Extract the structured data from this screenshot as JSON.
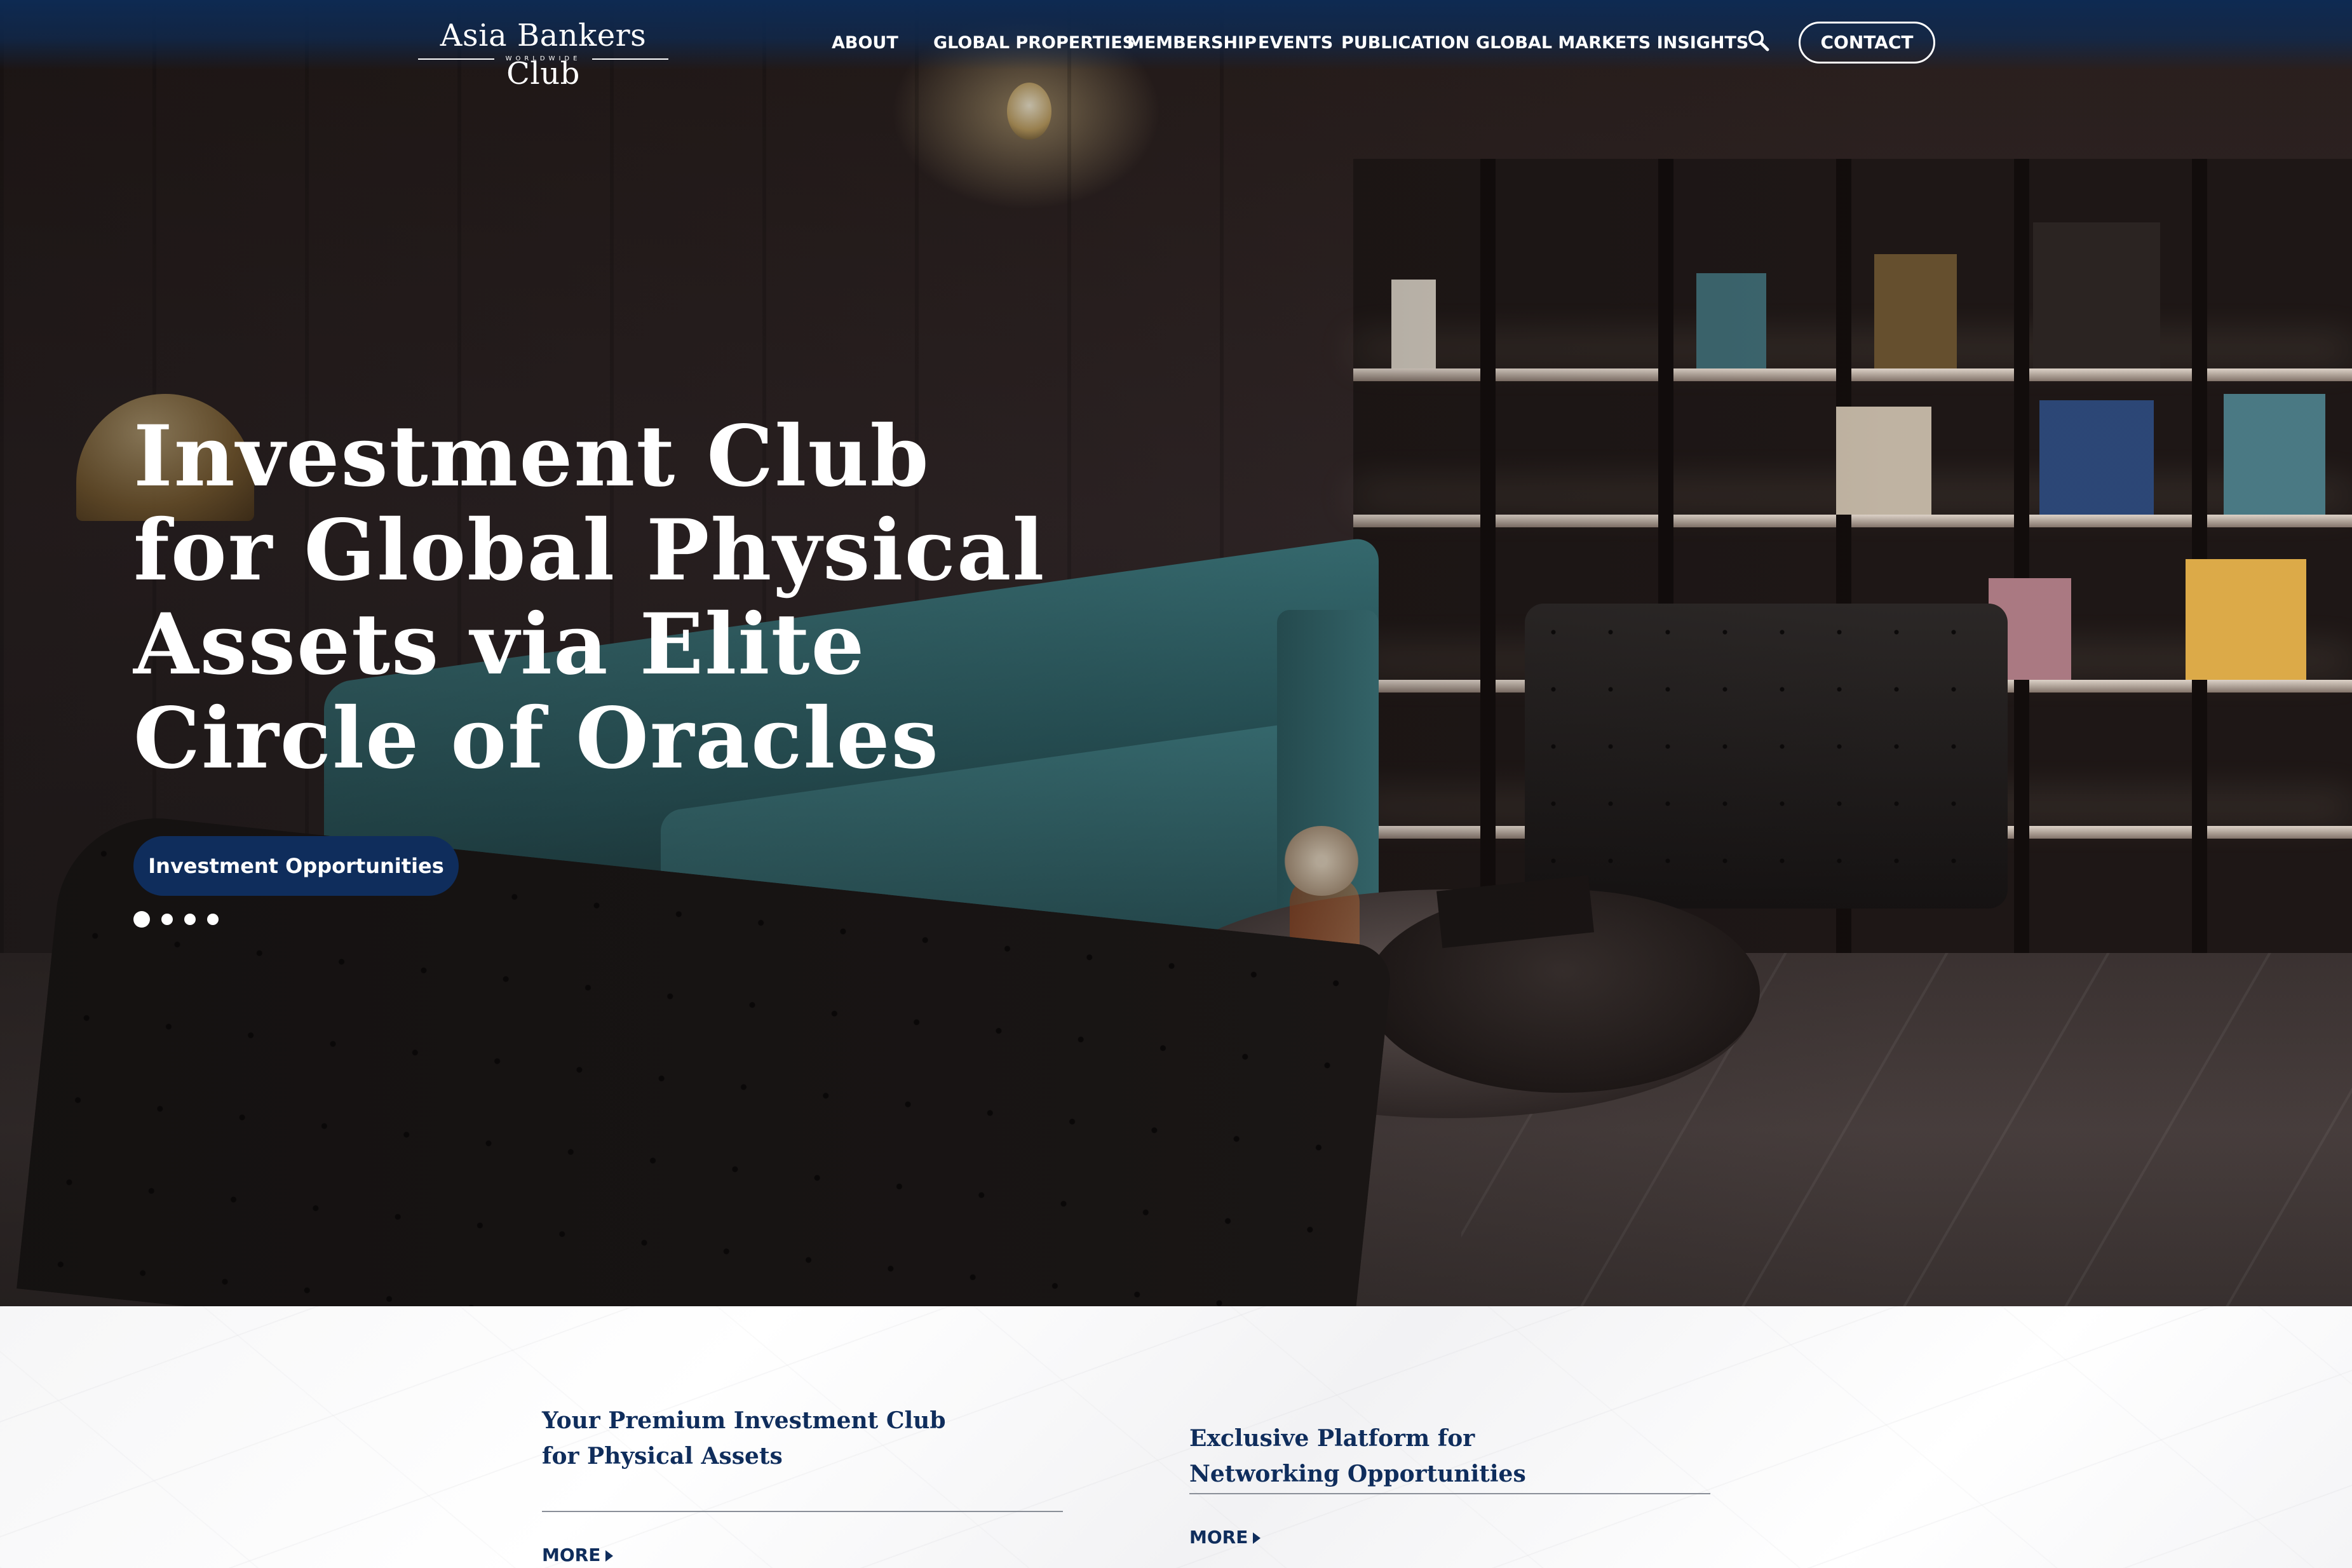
{
  "header": {
    "logo": {
      "name": "Asia Bankers Club",
      "tagline": "WORLDWIDE"
    },
    "nav": [
      {
        "label": "ABOUT"
      },
      {
        "label": "GLOBAL PROPERTIES"
      },
      {
        "label": "MEMBERSHIP"
      },
      {
        "label": "EVENTS"
      },
      {
        "label": "PUBLICATION"
      },
      {
        "label": "GLOBAL MARKETS INSIGHTS"
      }
    ],
    "search_icon": "search-icon",
    "contact_label": "CONTACT",
    "bar_color": "#0e2a52"
  },
  "hero": {
    "title_lines": [
      "Investment Club",
      "for Global Physical",
      "Assets via Elite",
      "Circle of Oracles"
    ],
    "cta_label": "Investment Opportunities",
    "cta_color": "#0f2d5c",
    "slides": {
      "count": 4,
      "active": 1
    }
  },
  "cards": [
    {
      "title_lines": [
        "Your Premium Investment Club",
        "for Physical Assets"
      ],
      "more_label": "MORE"
    },
    {
      "title_lines": [
        "Exclusive Platform for",
        "Networking Opportunities"
      ],
      "more_label": "MORE"
    }
  ],
  "colors": {
    "accent": "#0f2d5c",
    "text_on_dark": "#ffffff"
  }
}
